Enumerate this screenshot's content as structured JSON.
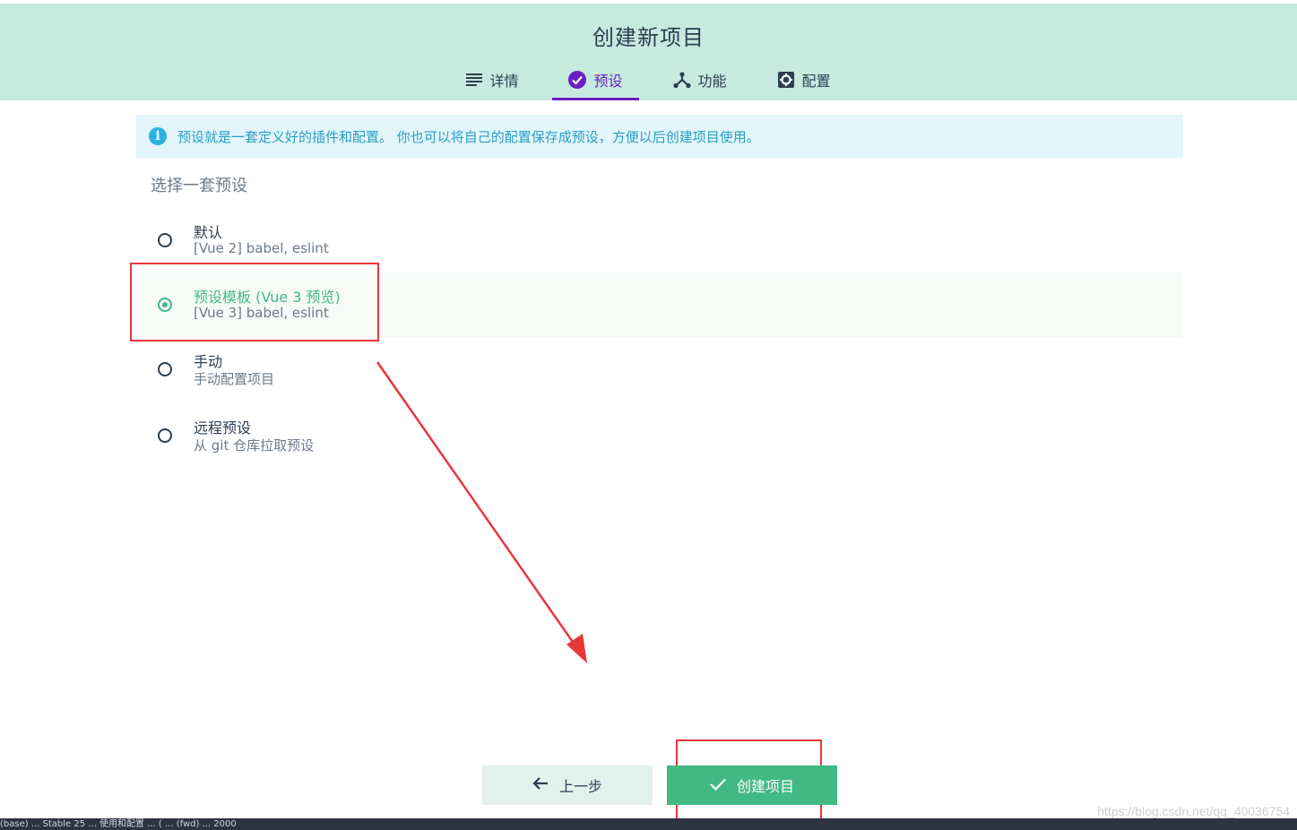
{
  "header": {
    "title": "创建新项目",
    "tabs": [
      {
        "label": "详情",
        "icon": "list-icon",
        "active": false
      },
      {
        "label": "预设",
        "icon": "check-circle-icon",
        "active": true
      },
      {
        "label": "功能",
        "icon": "fork-icon",
        "active": false
      },
      {
        "label": "配置",
        "icon": "gear-icon",
        "active": false
      }
    ],
    "background_color": "#c6eadd",
    "active_tab_color": "#6a1fc1"
  },
  "info": {
    "icon": "info-icon",
    "text": "预设就是一套定义好的插件和配置。 你也可以将自己的配置保存成预设，方便以后创建项目使用。"
  },
  "preset_section": {
    "title": "选择一套预设",
    "options": [
      {
        "name": "默认",
        "description": "[Vue 2] babel, eslint",
        "selected": false
      },
      {
        "name": "预设模板 (Vue 3 预览)",
        "description": "[Vue 3] babel, eslint",
        "selected": true
      },
      {
        "name": "手动",
        "description": "手动配置项目",
        "selected": false
      },
      {
        "name": "远程预设",
        "description": "从 git 仓库拉取预设",
        "selected": false
      }
    ]
  },
  "actions": {
    "back_label": "上一步",
    "create_label": "创建项目",
    "accent_color": "#42b983"
  },
  "status_bar": {
    "text": "(base) ... Stable 25 ... 使用和配置 ... ( ... (fwd) ... 2000"
  },
  "watermark": "https://blog.csdn.net/qq_40036754"
}
